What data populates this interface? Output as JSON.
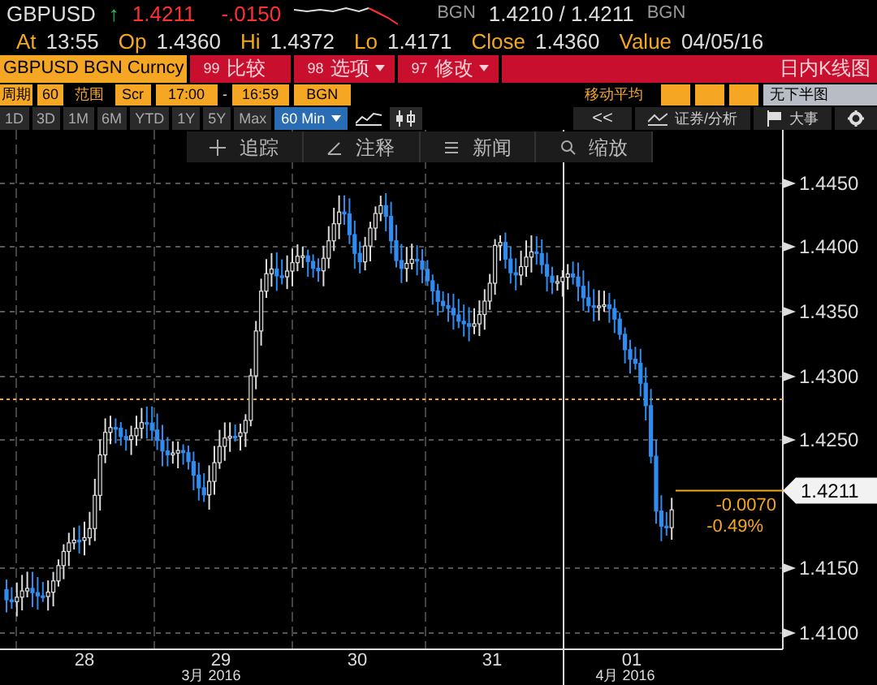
{
  "quote": {
    "ticker": "GBPUSD",
    "direction": "↑",
    "last": "1.4211",
    "change": "-.0150",
    "bid_source": "BGN",
    "bid_ask": "1.4210 / 1.4211",
    "ask_source": "BGN"
  },
  "stats": [
    {
      "label": "At",
      "value": "13:55"
    },
    {
      "label": "Op",
      "value": "1.4360"
    },
    {
      "label": "Hi",
      "value": "1.4372"
    },
    {
      "label": "Lo",
      "value": "1.4171"
    },
    {
      "label": "Close",
      "value": "1.4360"
    },
    {
      "label": "Value",
      "value": "04/05/16"
    }
  ],
  "security": "GBPUSD BGN Curncy",
  "actions": [
    {
      "number": "99",
      "label": "比较",
      "dropdown": false
    },
    {
      "number": "98",
      "label": "选项",
      "dropdown": true
    },
    {
      "number": "97",
      "label": "修改",
      "dropdown": true
    }
  ],
  "chart_title": "日内K线图",
  "settings": {
    "period_label": "周期",
    "period": "60",
    "range_label": "范围",
    "range_type": "Scr",
    "start": "17:00",
    "dash": "-",
    "end": "16:59",
    "source": "BGN",
    "ma_label": "移动平均",
    "lower_chart": "无下半图"
  },
  "periods": [
    {
      "label": "1D",
      "selected": false
    },
    {
      "label": "3D",
      "selected": false
    },
    {
      "label": "1M",
      "selected": false
    },
    {
      "label": "6M",
      "selected": false
    },
    {
      "label": "YTD",
      "selected": false
    },
    {
      "label": "1Y",
      "selected": false
    },
    {
      "label": "5Y",
      "selected": false
    },
    {
      "label": "Max",
      "selected": false
    }
  ],
  "interval": "60 Min",
  "toolbar": {
    "back": "<<",
    "analysis": "证券/分析",
    "events": "大事"
  },
  "chart_tools": [
    {
      "kind": "crosshair",
      "label": "追踪"
    },
    {
      "kind": "pen",
      "label": "注释"
    },
    {
      "kind": "news",
      "label": "新闻"
    },
    {
      "kind": "zoom",
      "label": "缩放"
    }
  ],
  "y_ticks": [
    "1.4450",
    "1.4400",
    "1.4350",
    "1.4300",
    "1.4250",
    "1.4150",
    "1.4100"
  ],
  "price_tag": "1.4211",
  "change_labels": [
    "-0.0070",
    "-0.49%"
  ],
  "x_labels": [
    "28",
    "29",
    "30",
    "31",
    "01"
  ],
  "month_labels": [
    "3月 2016",
    "4月 2016"
  ]
}
